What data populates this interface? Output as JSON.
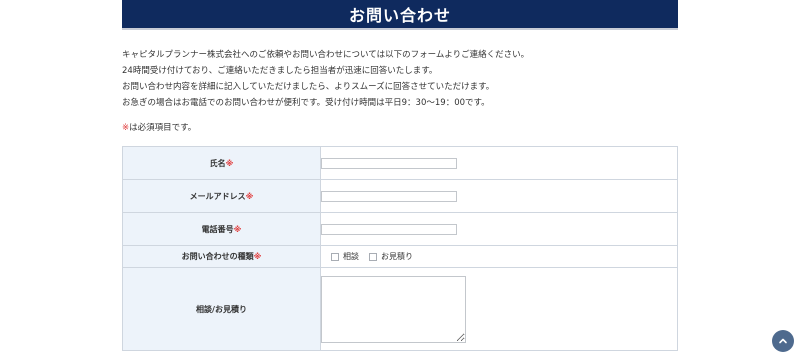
{
  "header": {
    "title": "お問い合わせ"
  },
  "intro": {
    "lines": [
      "キャピタルプランナー株式会社へのご依頼やお問い合わせについては以下のフォームよりご連絡ください。",
      "24時間受け付けており、ご連絡いただきましたら担当者が迅速に回答いたします。",
      "お問い合わせ内容を詳細に記入していただけましたら、よりスムーズに回答させていただけます。",
      "お急ぎの場合はお電話でのお問い合わせが便利です。受け付け時間は平日9：30〜19：00です。"
    ]
  },
  "required_note": {
    "mark": "※",
    "text": "は必須項目です。"
  },
  "form": {
    "required_mark": "※",
    "name_label": "氏名",
    "email_label": "メールアドレス",
    "phone_label": "電話番号",
    "inquiry_type_label": "お問い合わせの種類",
    "inquiry_options": [
      "相談",
      "お見積り"
    ],
    "message_label": "相談/お見積り"
  },
  "colors": {
    "banner": "#0f2a5e",
    "label_bg": "#edf3fa",
    "required": "#e03a3a",
    "to_top": "#4e6a8e"
  },
  "icons": {
    "scroll_top": "chevron-up-icon"
  }
}
